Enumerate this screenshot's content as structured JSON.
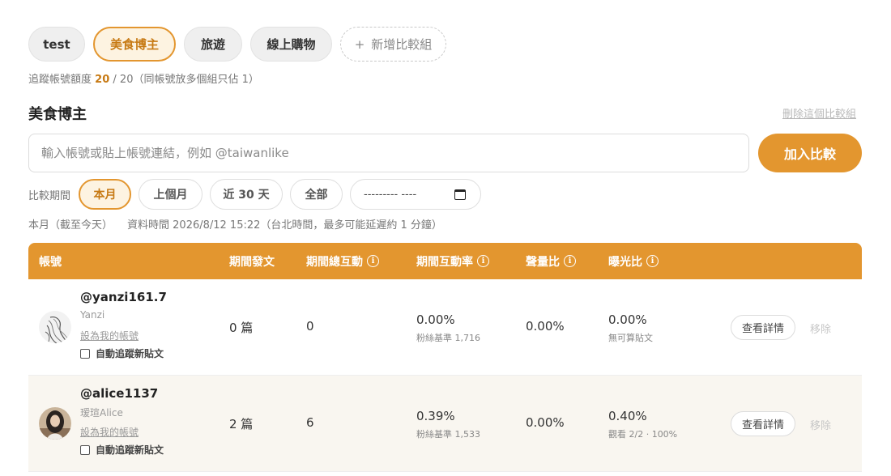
{
  "groups": [
    {
      "label": "test",
      "active": false
    },
    {
      "label": "美食博主",
      "active": true
    },
    {
      "label": "旅遊",
      "active": false
    },
    {
      "label": "線上購物",
      "active": false
    }
  ],
  "add_group_label": "新增比較組",
  "quota": {
    "prefix": "追蹤帳號額度",
    "used": "20",
    "sep": "/",
    "total": "20",
    "note": "（同帳號放多個組只佔 1）"
  },
  "group_title": "美食博主",
  "delete_group_label": "刪除這個比較組",
  "add_input": {
    "placeholder": "輸入帳號或貼上帳號連結，例如 @taiwanlike",
    "value": ""
  },
  "add_button_label": "加入比較",
  "period": {
    "label": "比較期間",
    "options": [
      "本月",
      "上個月",
      "近 30 天",
      "全部"
    ],
    "selected": "本月",
    "date_placeholder": "--------- ----"
  },
  "info": {
    "range": "本月（截至今天）",
    "data_time": "資料時間 2026/8/12 15:22（台北時間，最多可能延遲約 1 分鐘）"
  },
  "table": {
    "headers": {
      "account": "帳號",
      "posts": "期間發文",
      "interactions": "期間總互動",
      "engagement": "期間互動率",
      "voice": "聲量比",
      "exposure": "曝光比"
    },
    "rows": [
      {
        "handle": "@yanzi161.7",
        "display_name": "Yanzi",
        "set_mine": "設為我的帳號",
        "auto_track": "自動追蹤新貼文",
        "posts": "0 篇",
        "interactions": "0",
        "engagement": "0.00%",
        "engagement_sub": "粉絲基準 1,716",
        "voice": "0.00%",
        "exposure": "0.00%",
        "exposure_sub": "無可算貼文",
        "detail": "查看詳情",
        "remove": "移除"
      },
      {
        "handle": "@alice1137",
        "display_name": "瑷瑄Alice",
        "set_mine": "設為我的帳號",
        "auto_track": "自動追蹤新貼文",
        "posts": "2 篇",
        "interactions": "6",
        "engagement": "0.39%",
        "engagement_sub": "粉絲基準 1,533",
        "voice": "0.00%",
        "exposure": "0.40%",
        "exposure_sub": "觀看 2/2 · 100%",
        "detail": "查看詳情",
        "remove": "移除"
      }
    ]
  },
  "colors": {
    "accent": "#e3962f",
    "accent_text": "#c77a14",
    "accent_bg": "#fdf3e1",
    "row_alt": "#f9f6f0"
  }
}
